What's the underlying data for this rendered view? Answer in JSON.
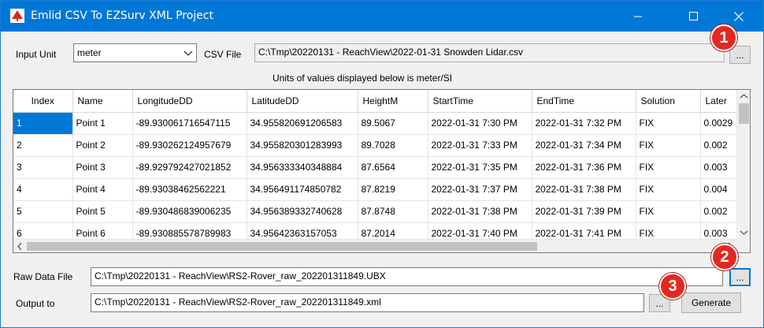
{
  "window": {
    "title": "Emlid CSV To EZSurv XML Project",
    "minimize_label": "Minimize",
    "maximize_label": "Maximize",
    "close_label": "Close"
  },
  "input_unit": {
    "label": "Input Unit",
    "value": "meter"
  },
  "csv_file": {
    "label": "CSV File",
    "value": "C:\\Tmp\\20220131 - ReachView\\2022-01-31 Snowden Lidar.csv",
    "browse_label": "..."
  },
  "units_note": "Units of values displayed below is meter/SI",
  "grid": {
    "columns": [
      "Index",
      "Name",
      "LongitudeDD",
      "LatitudeDD",
      "HeightM",
      "StartTime",
      "EndTime",
      "Solution",
      "Later"
    ],
    "rows": [
      [
        "1",
        "Point 1",
        "-89.930061716547115",
        "34.955820691206583",
        "89.5067",
        "2022-01-31 7:30 PM",
        "2022-01-31 7:32 PM",
        "FIX",
        "0.0029"
      ],
      [
        "2",
        "Point 2",
        "-89.930262124957679",
        "34.955820301283993",
        "89.7028",
        "2022-01-31 7:33 PM",
        "2022-01-31 7:34 PM",
        "FIX",
        "0.002"
      ],
      [
        "3",
        "Point 3",
        "-89.929792427021852",
        "34.956333340348884",
        "87.6564",
        "2022-01-31 7:35 PM",
        "2022-01-31 7:36 PM",
        "FIX",
        "0.003"
      ],
      [
        "4",
        "Point 4",
        "-89.93038462562221",
        "34.956491174850782",
        "87.8219",
        "2022-01-31 7:37 PM",
        "2022-01-31 7:38 PM",
        "FIX",
        "0.004"
      ],
      [
        "5",
        "Point 5",
        "-89.930486839006235",
        "34.956389332740628",
        "87.8748",
        "2022-01-31 7:38 PM",
        "2022-01-31 7:39 PM",
        "FIX",
        "0.002"
      ],
      [
        "6",
        "Point 6",
        "-89.930885578789983",
        "34.95642363157053",
        "87.2014",
        "2022-01-31 7:40 PM",
        "2022-01-31 7:41 PM",
        "FIX",
        "0.003"
      ]
    ]
  },
  "raw_data_file": {
    "label": "Raw Data File",
    "value": "C:\\Tmp\\20220131 - ReachView\\RS2-Rover_raw_202201311849.UBX",
    "browse_label": "..."
  },
  "output_to": {
    "label": "Output to",
    "value": "C:\\Tmp\\20220131 - ReachView\\RS2-Rover_raw_202201311849.xml",
    "browse_label": "..."
  },
  "generate_label": "Generate",
  "callouts": [
    "1",
    "2",
    "3"
  ],
  "colors": {
    "titlebar": "#0078d7",
    "selection": "#0078d7",
    "callout": "#e32822"
  }
}
